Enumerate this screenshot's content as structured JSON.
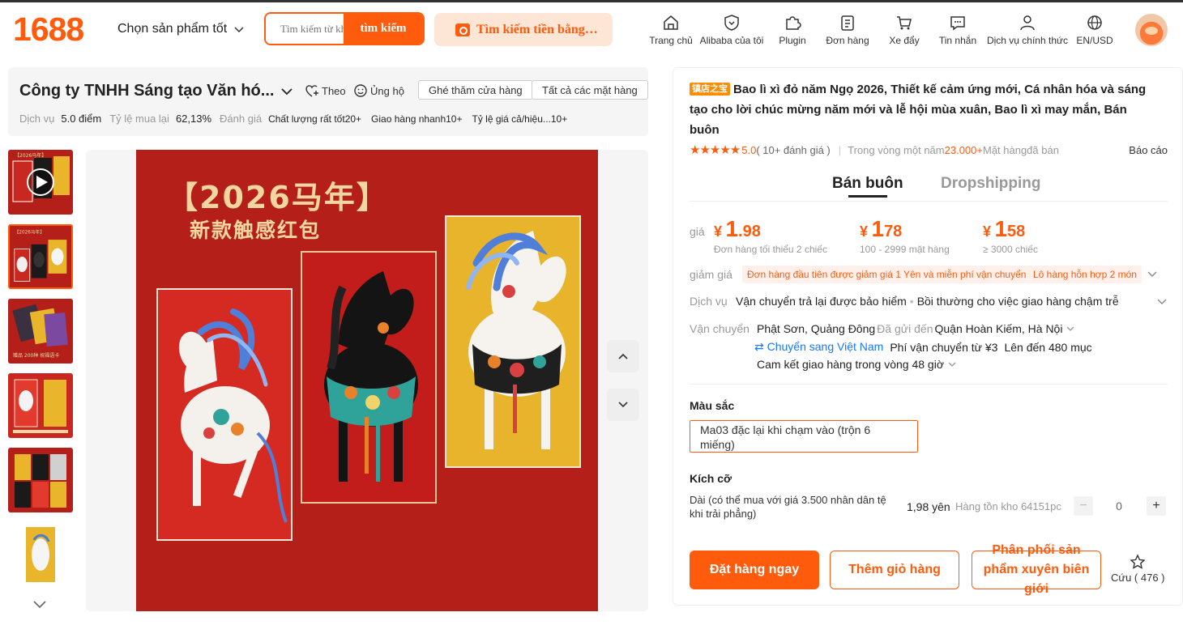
{
  "header": {
    "logo": "1688",
    "category_select": "Chọn sản phẩm tốt",
    "search_placeholder": "Tìm kiếm từ khóa",
    "search_button": "tìm kiếm",
    "image_search": "Tìm kiếm tiền bằng hình ảnh",
    "nav": [
      {
        "label": "Trang chủ",
        "icon": "home-icon"
      },
      {
        "label": "Alibaba của tôi",
        "icon": "shield-heart-icon"
      },
      {
        "label": "Plugin",
        "icon": "puzzle-icon"
      },
      {
        "label": "Đơn hàng",
        "icon": "clipboard-icon"
      },
      {
        "label": "Xe đẩy",
        "icon": "cart-icon"
      },
      {
        "label": "Tin nhắn",
        "icon": "chat-icon"
      },
      {
        "label": "Dịch vụ chính thức",
        "icon": "person-icon"
      },
      {
        "label": "EN/USD",
        "icon": "globe-icon"
      }
    ]
  },
  "store": {
    "name": "Công ty TNHH Sáng tạo Văn hó...",
    "follow": "Theo",
    "support": "Ủng hộ",
    "visit_store": "Ghé thăm cửa hàng",
    "all_items": "Tất cả các mặt hàng",
    "service_label": "Dịch vụ",
    "service_value": "5.0 điểm",
    "repurchase_label": "Tỷ lệ mua lại",
    "repurchase_value": "62,13%",
    "rating_label": "Đánh giá",
    "tags": [
      "Chất lượng rất tốt20+",
      "Giao hàng nhanh10+",
      "Tỷ lệ giá cả/hiệu...10+"
    ]
  },
  "gallery": {
    "poster_title": "【2026马年】",
    "poster_subtitle": "新款触感红包",
    "thumb_text_1": "【2026马年】",
    "thumb_text_3": "赠品 200种 祝福语卡"
  },
  "product": {
    "shop_badge": "镇店之宝",
    "title": "Bao lì xì đỏ năm Ngọ 2026, Thiết kế cảm ứng mới, Cá nhân hóa và sáng tạo cho lời chúc mừng năm mới và lễ hội mùa xuân, Bao lì xì may mắn, Bán buôn",
    "stars": "★★★★★",
    "rating_score": "5.0",
    "rating_count": "( 10+ đánh giá )",
    "sold_prefix": "Trong vòng một năm",
    "sold_value": "23.000+",
    "sold_suffix": " Mặt hàngđã bán",
    "report": "Báo cáo",
    "tab_wholesale": "Bán buôn",
    "tab_dropship": "Dropshipping",
    "price_label": "giá",
    "prices": [
      {
        "yen": "¥",
        "int": "1",
        "dec": ".98",
        "note": "Đơn hàng tối thiểu 2 chiếc"
      },
      {
        "yen": "¥",
        "int": "1",
        "dec": "78",
        "note": "100 - 2999 mặt hàng"
      },
      {
        "yen": "¥",
        "int": "1",
        "dec": "58",
        "note": "≥ 3000 chiếc"
      }
    ],
    "discount_label": "giảm giá",
    "promos": [
      "Đơn hàng đầu tiên được giảm giá 1 Yên và miễn phí vận chuyển",
      "Lô hàng hỗn hợp 2 món"
    ],
    "service_label": "Dịch vụ",
    "service_1": "Vận chuyển trả lại được bảo hiểm",
    "service_dot": "•",
    "service_2": "Bồi thường cho việc giao hàng chậm trễ",
    "shipping_label": "Vận chuyển",
    "ship_from": "Phật Sơn, Quảng Đông",
    "ship_sent_to": "Đã gửi đến",
    "ship_to": "Quận Hoàn Kiếm, Hà Nội",
    "ship_transfer": "⇄ Chuyển sang Việt Nam",
    "ship_fee": "Phí vận chuyển từ ¥3",
    "ship_up_to": "Lên đến 480 mục",
    "ship_promise": "Cam kết giao hàng trong vòng 48 giờ",
    "color_title": "Màu sắc",
    "color_option": "Ma03 đặc lại khi chạm vào (trộn 6 miếng)",
    "size_title": "Kích cỡ",
    "size_label": "Dài (có thể mua với giá 3.500 nhân dân tệ khi trải phẳng)",
    "size_price": "1,98 yên",
    "size_stock": "Hàng tồn kho 64151pc",
    "qty_minus": "−",
    "qty_value": "0",
    "qty_plus": "+",
    "btn_order": "Đặt hàng ngay",
    "btn_cart": "Thêm giỏ hàng",
    "btn_distribute": "Phân phối sản phẩm xuyên biên giới",
    "save_label": "Cứu ( 476 )"
  },
  "colors": {
    "accent": "#ff5b0d",
    "poster_red": "#b41f1a",
    "poster_gold": "#f2d6a0",
    "link_blue": "#1677ff"
  }
}
